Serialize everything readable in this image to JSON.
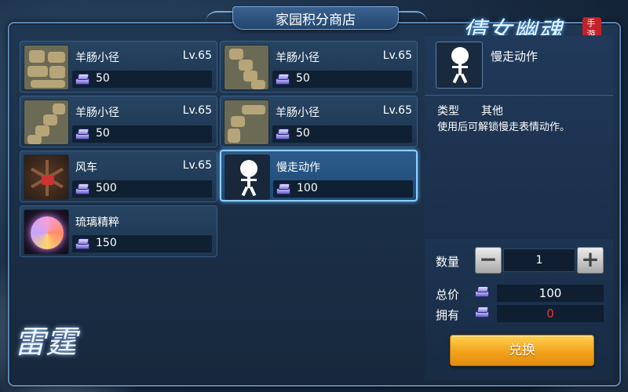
{
  "title": "家园积分商店",
  "logo": {
    "main": "倩女幽魂",
    "sub": "手游"
  },
  "corner_logo": "雷霆",
  "items": [
    {
      "name": "羊肠小径",
      "level": "Lv.65",
      "price": "50",
      "icon": "path-icon"
    },
    {
      "name": "羊肠小径",
      "level": "Lv.65",
      "price": "50",
      "icon": "path-icon"
    },
    {
      "name": "羊肠小径",
      "level": "Lv.65",
      "price": "50",
      "icon": "path-icon"
    },
    {
      "name": "羊肠小径",
      "level": "Lv.65",
      "price": "50",
      "icon": "path-icon"
    },
    {
      "name": "风车",
      "level": "Lv.65",
      "price": "500",
      "icon": "windmill-icon"
    },
    {
      "name": "慢走动作",
      "level": "",
      "price": "100",
      "icon": "emote-icon",
      "selected": true
    },
    {
      "name": "琉璃精粹",
      "level": "",
      "price": "150",
      "icon": "orb-icon"
    }
  ],
  "detail": {
    "name": "慢走动作",
    "type_label": "类型",
    "type_value": "其他",
    "description": "使用后可解锁慢走表情动作。"
  },
  "purchase": {
    "qty_label": "数量",
    "quantity": "1",
    "minus": "−",
    "plus": "+",
    "total_label": "总价",
    "total_value": "100",
    "own_label": "拥有",
    "own_value": "0",
    "exchange_label": "兑换"
  },
  "colors": {
    "own_value": "#e23a3a",
    "exchange_button": "#f2a21a",
    "selected_border": "#8fd0ff"
  }
}
